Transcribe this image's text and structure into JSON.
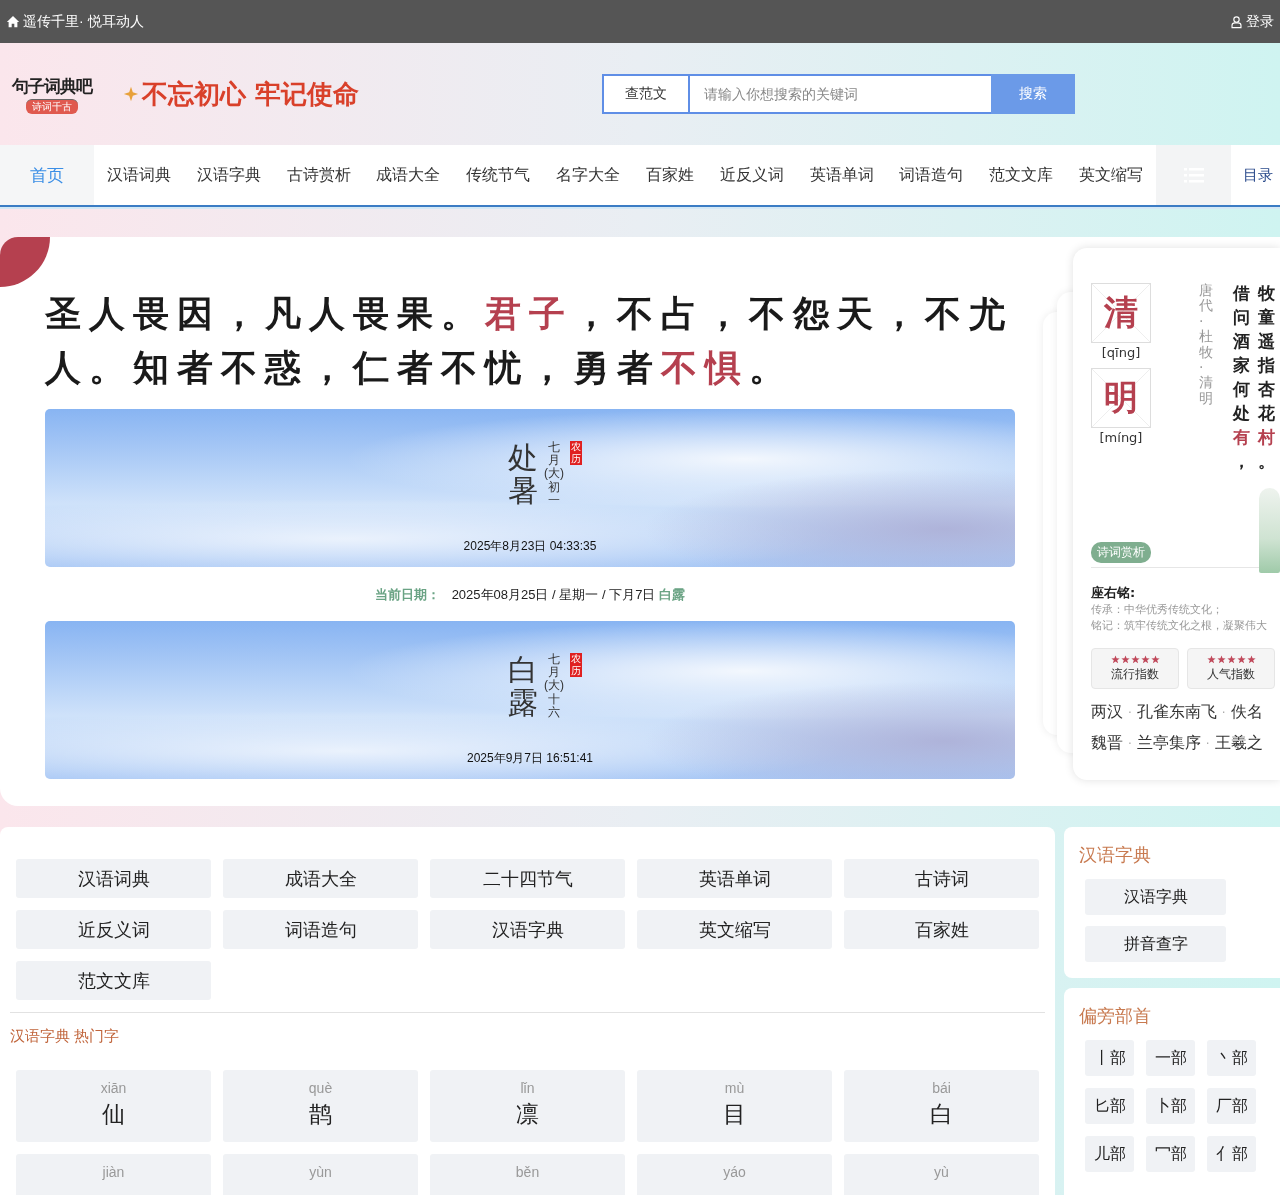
{
  "top_bar": {
    "title": "遥传千里· 悦耳动人",
    "login": "登录"
  },
  "header": {
    "logo": {
      "name": "句子词典吧",
      "tagline": "诗词千古"
    },
    "slogan": "不忘初心 牢记使命",
    "search": {
      "category": "查范文",
      "placeholder": "请输入你想搜索的关键词",
      "button": "搜索"
    }
  },
  "nav": {
    "items": [
      {
        "label": "首页",
        "selected": true
      },
      {
        "label": "汉语词典",
        "selected": false
      },
      {
        "label": "汉语字典",
        "selected": false
      },
      {
        "label": "古诗赏析",
        "selected": false
      },
      {
        "label": "成语大全",
        "selected": false
      },
      {
        "label": "传统节气",
        "selected": false
      },
      {
        "label": "名字大全",
        "selected": false
      },
      {
        "label": "百家姓",
        "selected": false
      },
      {
        "label": "近反义词",
        "selected": false
      },
      {
        "label": "英语单词",
        "selected": false
      },
      {
        "label": "词语造句",
        "selected": false
      },
      {
        "label": "范文文库",
        "selected": false
      },
      {
        "label": "英文缩写",
        "selected": false
      }
    ],
    "more": "目录"
  },
  "hero": {
    "quote": [
      {
        "text": "圣人畏因，凡人畏果。",
        "highlight": false
      },
      {
        "text": "君子",
        "highlight": true
      },
      {
        "text": "，不占，不怨天，不尤人。知者不惑，仁者不忧，勇者",
        "highlight": false
      },
      {
        "text": "不惧",
        "highlight": true
      },
      {
        "text": "。",
        "highlight": false
      }
    ],
    "solar_terms": [
      {
        "name": "处暑",
        "lunar": "七月(大)初一",
        "badge": "农历",
        "time": "2025年8月23日 04:33:35"
      },
      {
        "name": "白露",
        "lunar": "七月(大)十六",
        "badge": "农历",
        "time": "2025年9月7日 16:51:41"
      }
    ],
    "current_date": {
      "label": "当前日期：",
      "value": "2025年08月25日 / 星期一 / 下月7日",
      "term": "白露"
    }
  },
  "poem_card": {
    "chars": [
      {
        "char": "清",
        "pinyin": "[qīng]"
      },
      {
        "char": "明",
        "pinyin": "[míng]"
      }
    ],
    "source": "唐代·杜牧·清明",
    "columns": [
      {
        "text": "借问酒家何处",
        "highlight": "有",
        "end": "，"
      },
      {
        "text": "牧童遥指杏花",
        "highlight": "村",
        "end": "。"
      }
    ],
    "tag": "诗词赏析",
    "motto": {
      "title": "座右铭:",
      "lines": [
        "传承：中华优秀传统文化；",
        "铭记：筑牢传统文化之根，凝聚伟大"
      ]
    },
    "ratings": [
      {
        "label": "流行指数",
        "stars": 5
      },
      {
        "label": "人气指数",
        "stars": 5
      }
    ],
    "separator": "·",
    "related": [
      {
        "dynasty": "两汉",
        "title": "孔雀东南飞",
        "author": "佚名"
      },
      {
        "dynasty": "魏晋",
        "title": "兰亭集序",
        "author": "王羲之"
      }
    ]
  },
  "links": {
    "items": [
      "汉语词典",
      "成语大全",
      "二十四节气",
      "英语单词",
      "古诗词",
      "近反义词",
      "词语造句",
      "汉语字典",
      "英文缩写",
      "百家姓",
      "范文文库"
    ],
    "hot_title": "汉语字典 热门字",
    "hot_chars": [
      {
        "pinyin": "xiān",
        "char": "仙"
      },
      {
        "pinyin": "què",
        "char": "鹊"
      },
      {
        "pinyin": "lǐn",
        "char": "凛"
      },
      {
        "pinyin": "mù",
        "char": "目"
      },
      {
        "pinyin": "bái",
        "char": "白"
      },
      {
        "pinyin": "jiàn"
      },
      {
        "pinyin": "yùn"
      },
      {
        "pinyin": "běn"
      },
      {
        "pinyin": "yáo"
      },
      {
        "pinyin": "yù"
      }
    ]
  },
  "side": {
    "dictionary": {
      "title": "汉语字典",
      "items": [
        "汉语字典",
        "拼音查字"
      ]
    },
    "radicals": {
      "title": "偏旁部首",
      "items": [
        "丨部",
        "一部",
        "丶部",
        "匕部",
        "卜部",
        "厂部",
        "儿部",
        "冖部",
        "亻部"
      ]
    }
  }
}
